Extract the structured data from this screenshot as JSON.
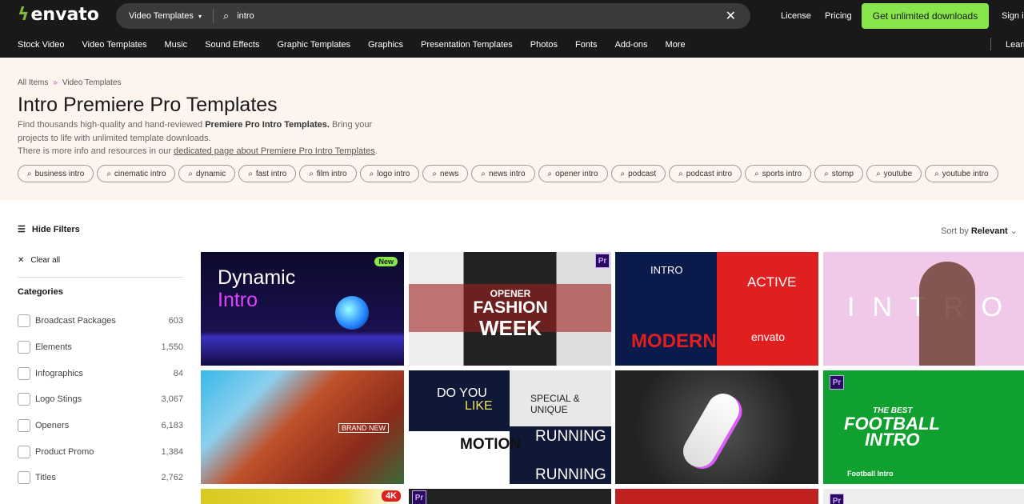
{
  "header": {
    "logo": "envato",
    "search_category": "Video Templates",
    "search_query": "intro",
    "license": "License",
    "pricing": "Pricing",
    "cta": "Get unlimited downloads",
    "sign_in": "Sign in"
  },
  "nav": [
    "Stock Video",
    "Video Templates",
    "Music",
    "Sound Effects",
    "Graphic Templates",
    "Graphics",
    "Presentation Templates",
    "Photos",
    "Fonts",
    "Add-ons",
    "More"
  ],
  "nav_right": "Learn",
  "breadcrumb": {
    "root": "All Items",
    "sep": "»",
    "current": "Video Templates"
  },
  "title": "Intro Premiere Pro Templates",
  "desc": {
    "p1": "Find thousands high-quality and hand-reviewed ",
    "bold": "Premiere Pro Intro Templates.",
    "p2": " Bring your projects to life with unlimited template downloads.",
    "p3": "There is more info and resources in our ",
    "link": "dedicated page about Premiere Pro Intro Templates",
    "p4": "."
  },
  "tags": [
    "business intro",
    "cinematic intro",
    "dynamic",
    "fast intro",
    "film intro",
    "logo intro",
    "news",
    "news intro",
    "opener intro",
    "podcast",
    "podcast intro",
    "sports intro",
    "stomp",
    "youtube",
    "youtube intro"
  ],
  "filters": {
    "hide": "Hide Filters",
    "clear": "Clear all",
    "categories_title": "Categories",
    "categories": [
      {
        "label": "Broadcast Packages",
        "count": "603"
      },
      {
        "label": "Elements",
        "count": "1,550"
      },
      {
        "label": "Infographics",
        "count": "84"
      },
      {
        "label": "Logo Stings",
        "count": "3,067"
      },
      {
        "label": "Openers",
        "count": "6,183"
      },
      {
        "label": "Product Promo",
        "count": "1,384"
      },
      {
        "label": "Titles",
        "count": "2,762"
      }
    ]
  },
  "sort": {
    "label": "Sort by",
    "value": "Relevant"
  },
  "thumbs": {
    "t1": "Dynamic",
    "t1b": "Intro",
    "new": "New",
    "t2a": "OPENER",
    "t2b": "FASHION",
    "t2c": "WEEK",
    "pr": "Pr",
    "t3a": "INTRO",
    "t3b": "ACTIVE",
    "t3c": "envato",
    "t3d": "MODERN",
    "t4": "INTRO",
    "t5": "BRAND NEW",
    "t6a": "DO YOU",
    "t6b": "LIKE",
    "t6c": "SPECIAL & UNIQUE",
    "t6d": "MOTION",
    "t6e": "RUNNING",
    "t8a": "THE BEST",
    "t8b": "FOOTBALL",
    "t8c": "INTRO",
    "t8d": "Football Intro",
    "k4": "4K"
  }
}
